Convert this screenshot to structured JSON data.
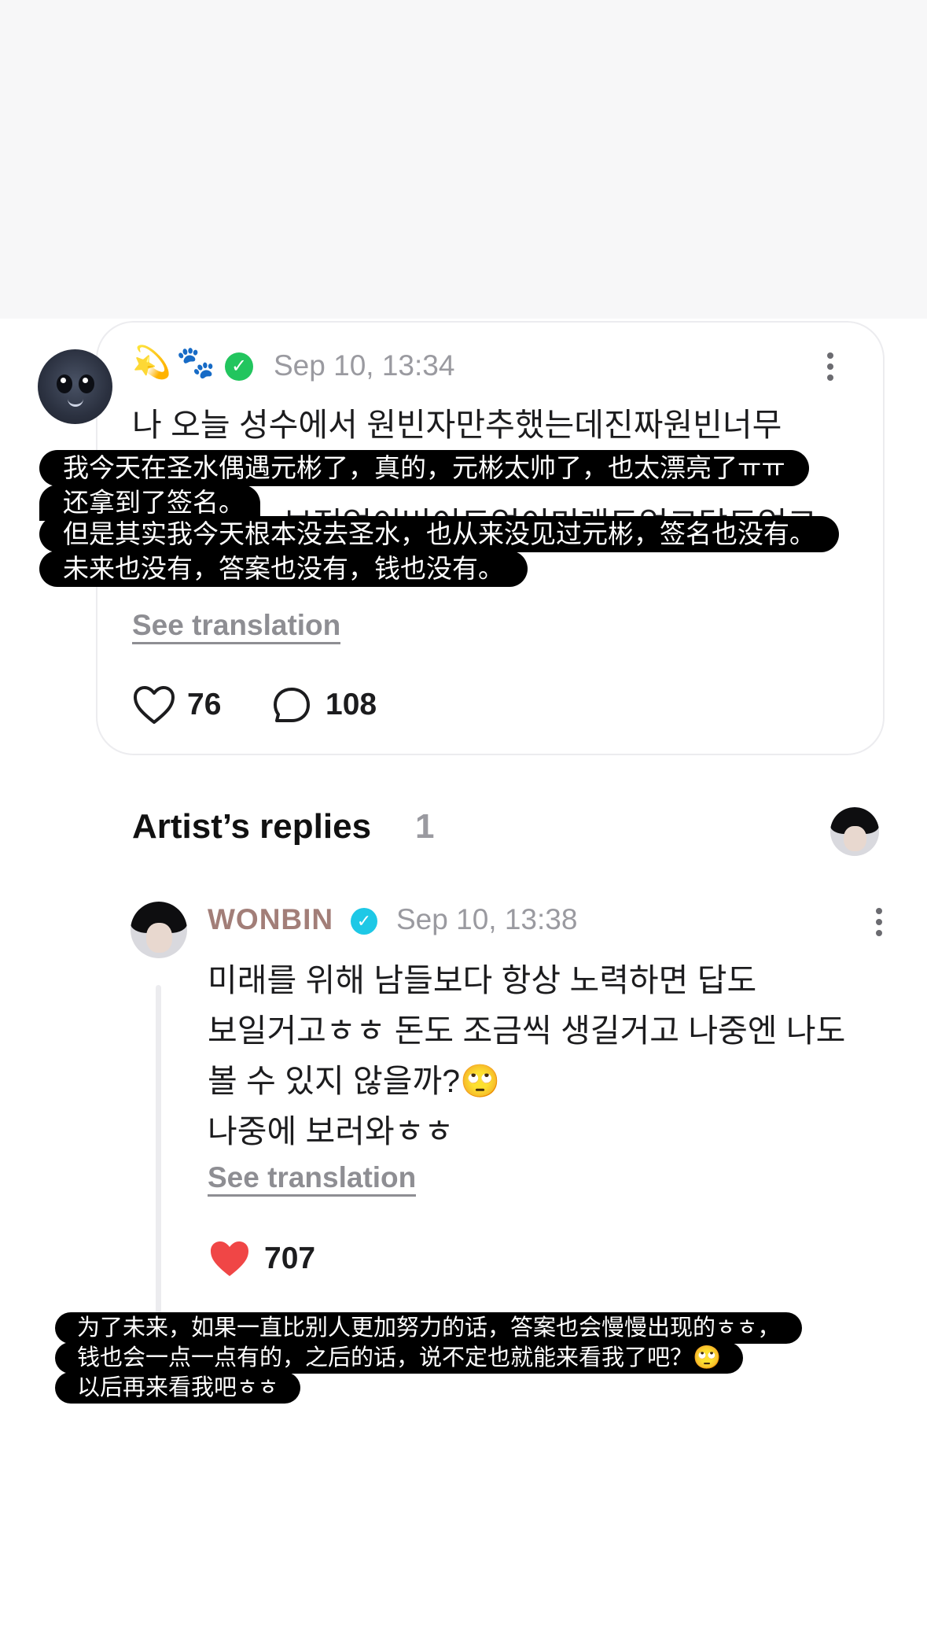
{
  "fan_post": {
    "emojis": [
      "💫",
      "🐾"
    ],
    "icons": [
      "verified-badge-icon",
      "cat-avatar-icon",
      "more-options-icon"
    ],
    "timestamp": "Sep 10, 13:34",
    "text_line1": "나 오늘 성수에서 원빈자만추했는데진짜원빈너무",
    "text_line2": "보정없이버이도없이미래도없고답도없고",
    "see_translation": "See translation",
    "likes": "76",
    "comments": "108",
    "translation_overlay": [
      "我今天在圣水偶遇元彬了，真的，元彬太帅了，也太漂亮了ㅠㅠ",
      "还拿到了签名。",
      "但是其实我今天根本没去圣水，也从来没见过元彬，签名也没有。",
      "未来也没有，答案也没有，钱也没有。"
    ]
  },
  "artist_replies": {
    "title": "Artist’s replies",
    "count": "1"
  },
  "artist_reply": {
    "name": "WONBIN",
    "timestamp": "Sep 10, 13:38",
    "lines": [
      "미래를 위해 남들보다 항상 노력하면 답도",
      "보일거고ㅎㅎ 돈도 조금씩 생길거고 나중엔  나도",
      "볼 수 있지 않을까?🙄",
      "나중에 보러와ㅎㅎ"
    ],
    "see_translation": "See translation",
    "likes": "707",
    "translation_overlay": [
      "为了未来，如果一直比别人更加努力的话，答案也会慢慢出现的ㅎㅎ，",
      "钱也会一点一点有的，之后的话，说不定也就能来看我了吧？🙄",
      "以后再来看我吧ㅎㅎ"
    ]
  },
  "colors": {
    "like_red": "#f04646",
    "artist_name": "#a27e78",
    "verified_green": "#22c55e",
    "verified_blue": "#1ec8e6",
    "timestamp_gray": "#9a9aa0"
  }
}
